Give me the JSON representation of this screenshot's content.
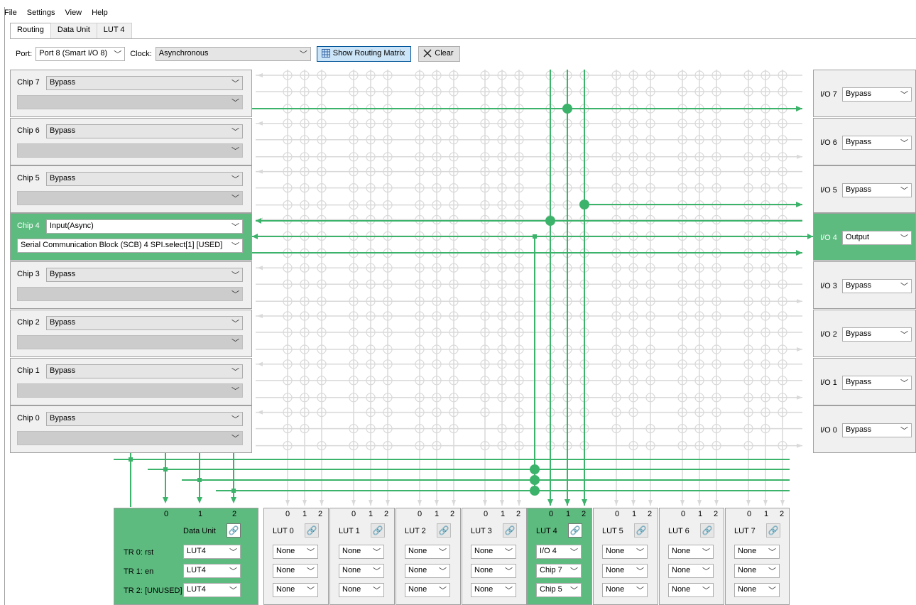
{
  "menu": {
    "file": "File",
    "settings": "Settings",
    "view": "View",
    "help": "Help"
  },
  "tabs": [
    "Routing",
    "Data Unit",
    "LUT 4"
  ],
  "toolbar": {
    "port_label": "Port:",
    "port_value": "Port 8 (Smart I/O 8)",
    "clock_label": "Clock:",
    "clock_value": "Asynchronous",
    "show_matrix": "Show Routing Matrix",
    "clear": "Clear"
  },
  "chips": [
    {
      "label": "Chip 7",
      "mode": "Bypass",
      "signal": "",
      "active": false
    },
    {
      "label": "Chip 6",
      "mode": "Bypass",
      "signal": "",
      "active": false
    },
    {
      "label": "Chip 5",
      "mode": "Bypass",
      "signal": "",
      "active": false
    },
    {
      "label": "Chip 4",
      "mode": "Input(Async)",
      "signal": "Serial Communication Block (SCB) 4 SPI.select[1] [USED]",
      "active": true
    },
    {
      "label": "Chip 3",
      "mode": "Bypass",
      "signal": "",
      "active": false
    },
    {
      "label": "Chip 2",
      "mode": "Bypass",
      "signal": "",
      "active": false
    },
    {
      "label": "Chip 1",
      "mode": "Bypass",
      "signal": "",
      "active": false
    },
    {
      "label": "Chip 0",
      "mode": "Bypass",
      "signal": "",
      "active": false
    }
  ],
  "ios": [
    {
      "label": "I/O 7",
      "mode": "Bypass",
      "active": false
    },
    {
      "label": "I/O 6",
      "mode": "Bypass",
      "active": false
    },
    {
      "label": "I/O 5",
      "mode": "Bypass",
      "active": false
    },
    {
      "label": "I/O 4",
      "mode": "Output",
      "active": true
    },
    {
      "label": "I/O 3",
      "mode": "Bypass",
      "active": false
    },
    {
      "label": "I/O 2",
      "mode": "Bypass",
      "active": false
    },
    {
      "label": "I/O 1",
      "mode": "Bypass",
      "active": false
    },
    {
      "label": "I/O 0",
      "mode": "Bypass",
      "active": false
    }
  ],
  "data_unit": {
    "name": "Data Unit",
    "inputs": [
      "0",
      "1",
      "2"
    ],
    "triggers": [
      {
        "label": "TR 0: rst",
        "value": "LUT4"
      },
      {
        "label": "TR 1: en",
        "value": "LUT4"
      },
      {
        "label": "TR 2: [UNUSED]",
        "value": "LUT4"
      }
    ]
  },
  "luts": [
    {
      "name": "LUT 0",
      "inputs": [
        "None",
        "None",
        "None"
      ],
      "active": false
    },
    {
      "name": "LUT 1",
      "inputs": [
        "None",
        "None",
        "None"
      ],
      "active": false
    },
    {
      "name": "LUT 2",
      "inputs": [
        "None",
        "None",
        "None"
      ],
      "active": false
    },
    {
      "name": "LUT 3",
      "inputs": [
        "None",
        "None",
        "None"
      ],
      "active": false
    },
    {
      "name": "LUT 4",
      "inputs": [
        "I/O 4",
        "Chip 7",
        "Chip 5"
      ],
      "active": true
    },
    {
      "name": "LUT 5",
      "inputs": [
        "None",
        "None",
        "None"
      ],
      "active": false
    },
    {
      "name": "LUT 6",
      "inputs": [
        "None",
        "None",
        "None"
      ],
      "active": false
    },
    {
      "name": "LUT 7",
      "inputs": [
        "None",
        "None",
        "None"
      ],
      "active": false
    }
  ],
  "lut_input_numbers": [
    "0",
    "1",
    "2"
  ],
  "icons": {
    "matrix": "grid-icon",
    "clear": "x-icon",
    "link": "link-icon",
    "dropdown": "chevron-down-icon"
  },
  "colors": {
    "active_green": "#5dbb7f",
    "route_green": "#3cb36a",
    "grid_gray": "#d9d9d9"
  }
}
